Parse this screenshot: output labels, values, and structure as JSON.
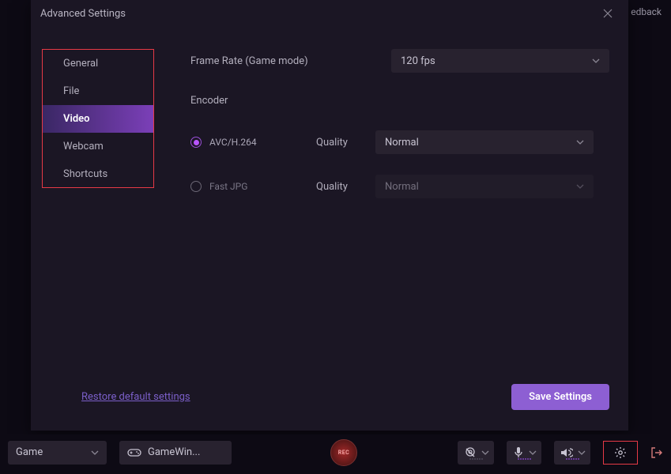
{
  "modal": {
    "title": "Advanced Settings",
    "sidebar": {
      "items": [
        {
          "label": "General"
        },
        {
          "label": "File"
        },
        {
          "label": "Video"
        },
        {
          "label": "Webcam"
        },
        {
          "label": "Shortcuts"
        }
      ],
      "active_index": 2
    },
    "frame_rate": {
      "label": "Frame Rate (Game mode)",
      "value": "120 fps"
    },
    "encoder": {
      "label": "Encoder",
      "options": [
        {
          "label": "AVC/H.264",
          "selected": true,
          "quality_label": "Quality",
          "quality_value": "Normal"
        },
        {
          "label": "Fast JPG",
          "selected": false,
          "quality_label": "Quality",
          "quality_value": "Normal"
        }
      ]
    },
    "restore_label": "Restore default settings",
    "save_label": "Save Settings"
  },
  "header": {
    "feedback": "edback"
  },
  "toolbar": {
    "mode": "Game",
    "game": "GameWin...",
    "rec_label": "REC"
  }
}
